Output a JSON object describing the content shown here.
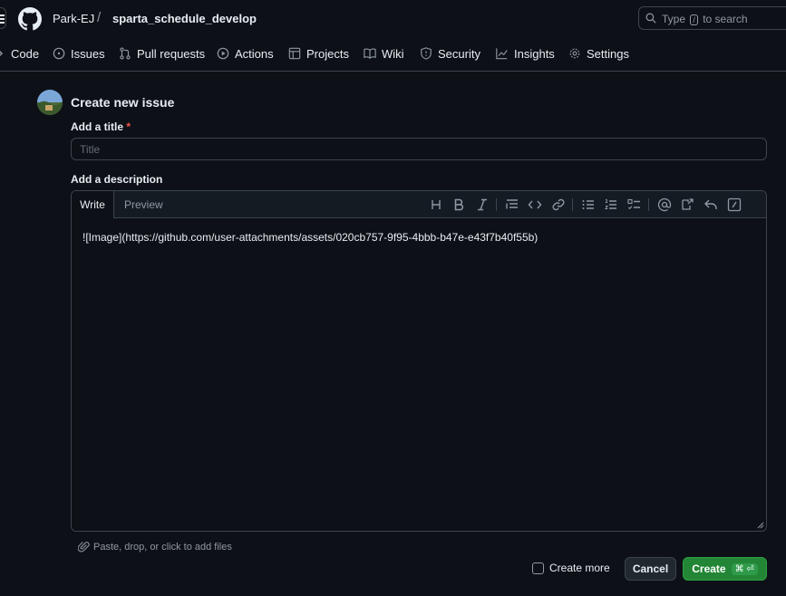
{
  "header": {
    "owner": "Park-EJ",
    "separator": "/",
    "repo": "sparta_schedule_develop",
    "search": {
      "prefix": "Type",
      "key": "/",
      "suffix": "to search"
    }
  },
  "nav": [
    {
      "label": "Code",
      "icon": "code-icon"
    },
    {
      "label": "Issues",
      "icon": "issue-opened-icon"
    },
    {
      "label": "Pull requests",
      "icon": "git-pull-request-icon"
    },
    {
      "label": "Actions",
      "icon": "play-icon"
    },
    {
      "label": "Projects",
      "icon": "table-icon"
    },
    {
      "label": "Wiki",
      "icon": "book-icon"
    },
    {
      "label": "Security",
      "icon": "shield-icon"
    },
    {
      "label": "Insights",
      "icon": "graph-icon"
    },
    {
      "label": "Settings",
      "icon": "gear-icon"
    }
  ],
  "form": {
    "heading": "Create new issue",
    "title_label": "Add a title",
    "required_mark": "*",
    "title_placeholder": "Title",
    "title_value": "",
    "description_label": "Add a description",
    "tabs": {
      "write": "Write",
      "preview": "Preview"
    },
    "toolbar": [
      "heading-icon",
      "bold-icon",
      "italic-icon",
      "quote-icon",
      "code-icon",
      "link-icon",
      "unordered-list-icon",
      "ordered-list-icon",
      "task-list-icon",
      "mention-icon",
      "cross-reference-icon",
      "reply-icon",
      "slash-commands-icon"
    ],
    "description_value": "![Image](https://github.com/user-attachments/assets/020cb757-9f95-4bbb-b47e-e43f7b40f55b)",
    "attach_hint": "Paste, drop, or click to add files",
    "create_more_label": "Create more",
    "cancel_label": "Cancel",
    "create_label": "Create",
    "create_shortcut": "⌘ ⏎"
  },
  "colors": {
    "background": "#0d1117",
    "border": "#3d444d",
    "text": "#e6edf3",
    "muted": "#9198a1",
    "primary_button": "#238636",
    "required": "#f85149"
  }
}
